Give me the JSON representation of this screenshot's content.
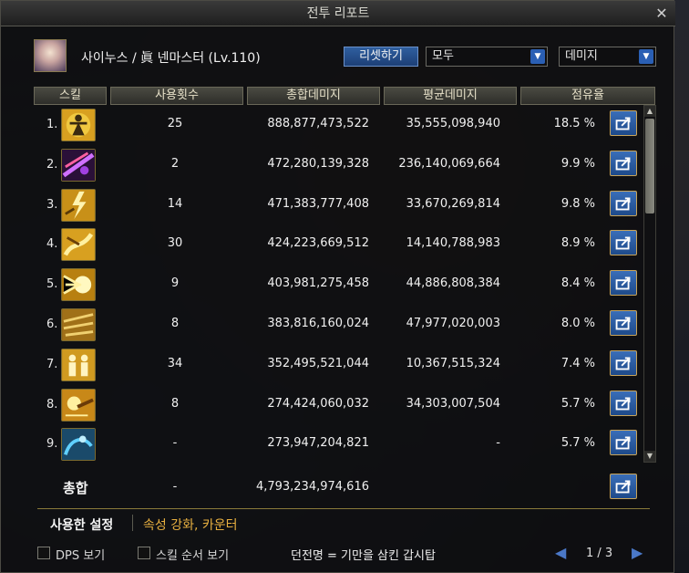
{
  "window": {
    "title": "전투 리포트"
  },
  "character": {
    "name": "사이누스 / 眞 넨마스터 (Lv.110)"
  },
  "controls": {
    "reset_label": "리셋하기",
    "filter_value": "모두",
    "metric_value": "데미지"
  },
  "columns": [
    "스킬",
    "사용횟수",
    "총합데미지",
    "평균데미지",
    "점유율"
  ],
  "rows": [
    {
      "rank": "1.",
      "icon": "golden-figure-icon",
      "uses": "25",
      "total": "888,877,473,522",
      "avg": "35,555,098,940",
      "share": "18.5 %"
    },
    {
      "rank": "2.",
      "icon": "purple-slash-icon",
      "uses": "2",
      "total": "472,280,139,328",
      "avg": "236,140,069,664",
      "share": "9.9 %"
    },
    {
      "rank": "3.",
      "icon": "lightning-burst-icon",
      "uses": "14",
      "total": "471,383,777,408",
      "avg": "33,670,269,814",
      "share": "9.8 %"
    },
    {
      "rank": "4.",
      "icon": "dragon-strike-icon",
      "uses": "30",
      "total": "424,223,669,512",
      "avg": "14,140,788,983",
      "share": "8.9 %"
    },
    {
      "rank": "5.",
      "icon": "radiant-burst-icon",
      "uses": "9",
      "total": "403,981,275,458",
      "avg": "44,886,808,384",
      "share": "8.4 %"
    },
    {
      "rank": "6.",
      "icon": "wind-slash-icon",
      "uses": "8",
      "total": "383,816,160,024",
      "avg": "47,977,020,003",
      "share": "8.0 %"
    },
    {
      "rank": "7.",
      "icon": "twin-figures-icon",
      "uses": "34",
      "total": "352,495,521,044",
      "avg": "10,367,515,324",
      "share": "7.4 %"
    },
    {
      "rank": "8.",
      "icon": "energy-orb-icon",
      "uses": "8",
      "total": "274,424,060,032",
      "avg": "34,303,007,504",
      "share": "5.7 %"
    },
    {
      "rank": "9.",
      "icon": "blue-kick-icon",
      "uses": "-",
      "total": "273,947,204,821",
      "avg": "-",
      "share": "5.7 %"
    }
  ],
  "total": {
    "label": "총합",
    "uses": "-",
    "value": "4,793,234,974,616"
  },
  "settings": {
    "label": "사용한 설정",
    "value": "속성 강화, 카운터"
  },
  "footer": {
    "dps_label": "DPS 보기",
    "order_label": "스킬 순서 보기",
    "dungeon": "던전명 = 기만을 삼킨 갑시탑",
    "page": "1 / 3"
  },
  "colors": {
    "accent": "#e8b040",
    "button_blue": "#2f5f9f"
  }
}
